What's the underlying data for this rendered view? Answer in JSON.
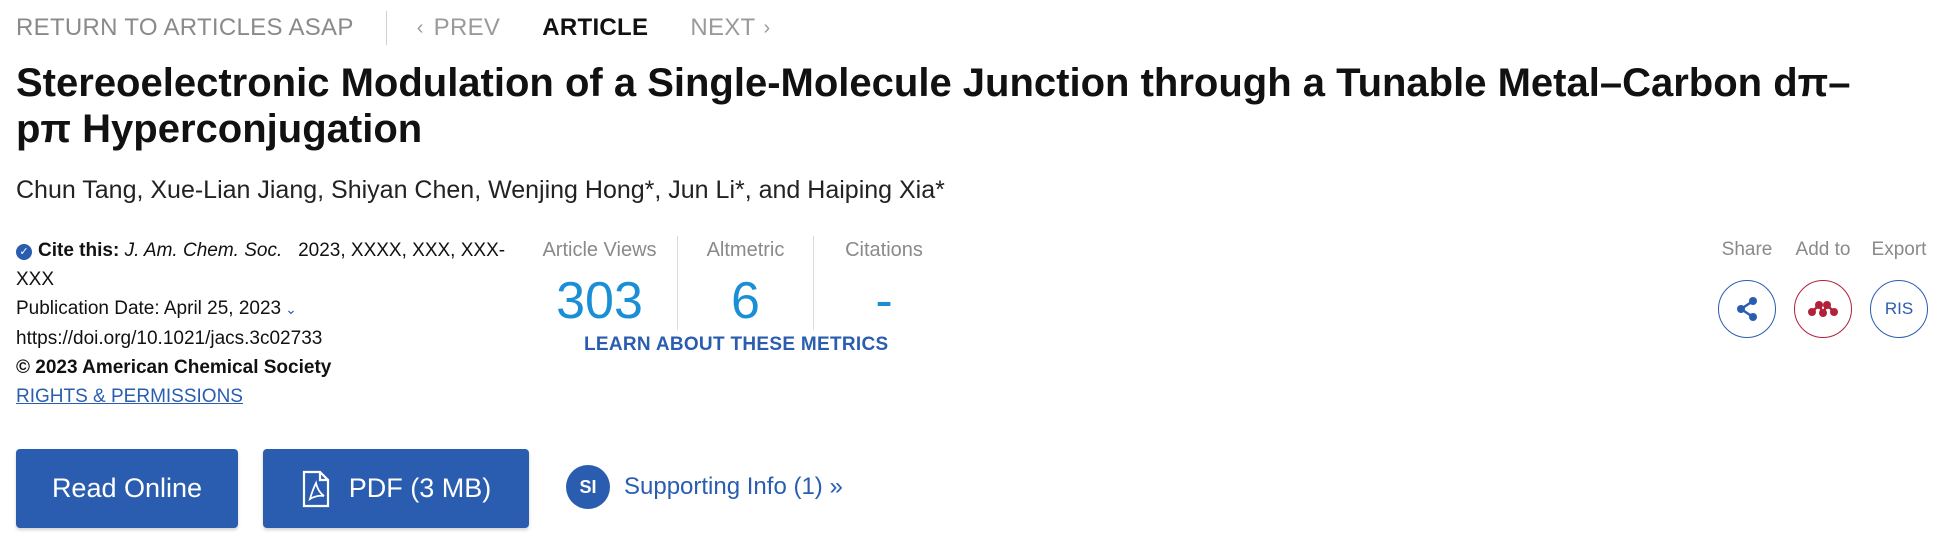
{
  "nav": {
    "return_label": "RETURN TO ARTICLES ASAP",
    "prev_label": "PREV",
    "article_label": "ARTICLE",
    "next_label": "NEXT"
  },
  "article": {
    "title": "Stereoelectronic Modulation of a Single-Molecule Junction through a Tunable Metal–Carbon dπ–pπ Hyperconjugation",
    "authors": "Chun Tang, Xue-Lian Jiang, Shiyan Chen, Wenjing Hong*, Jun Li*, and Haiping Xia*"
  },
  "cite": {
    "label": "Cite this:",
    "journal": "J. Am. Chem. Soc.",
    "reference": "2023, XXXX, XXX, XXX-XXX",
    "pub_date": "Publication Date: April 25, 2023",
    "doi": "https://doi.org/10.1021/jacs.3c02733",
    "copyright": "© 2023 American Chemical Society",
    "rights": "RIGHTS & PERMISSIONS"
  },
  "metrics": {
    "views_label": "Article Views",
    "views_value": "303",
    "altmetric_label": "Altmetric",
    "altmetric_value": "6",
    "citations_label": "Citations",
    "citations_value": "-",
    "learn_label": "LEARN ABOUT THESE METRICS"
  },
  "tools": {
    "share_label": "Share",
    "add_label": "Add to",
    "export_label": "Export",
    "export_button": "RIS",
    "share_icon": "share-icon",
    "add_icon": "mendeley-icon"
  },
  "actions": {
    "read_online": "Read Online",
    "pdf": "PDF (3 MB)",
    "si_badge": "SI",
    "supporting_info": "Supporting Info (1) »"
  },
  "colors": {
    "accent": "#2a5db0",
    "metric_value": "#1b8fd6",
    "mendeley": "#b3203a"
  }
}
